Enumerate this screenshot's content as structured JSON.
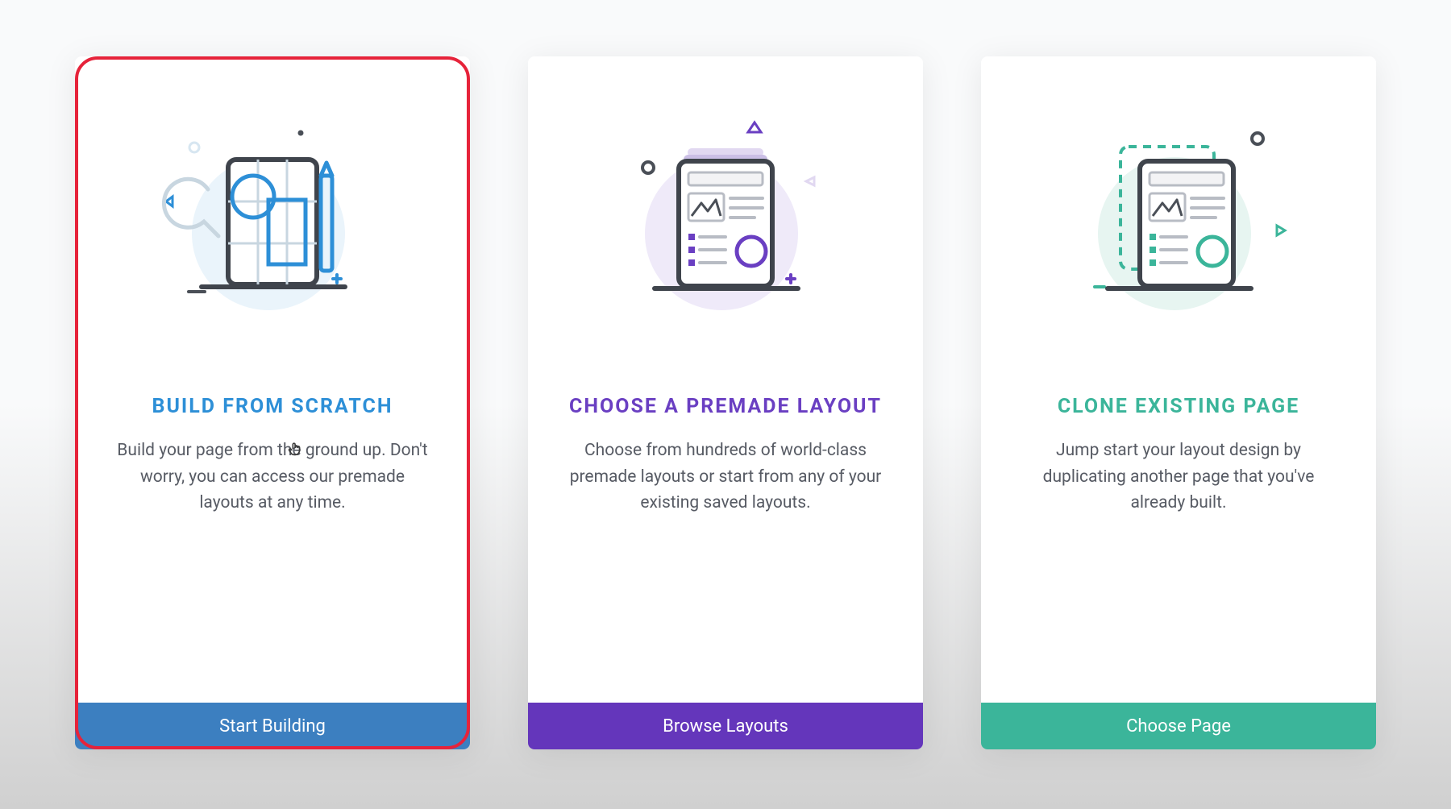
{
  "cards": [
    {
      "title": "BUILD FROM SCRATCH",
      "desc": "Build your page from the ground up. Don't worry, you can access our premade layouts at any time.",
      "button": "Start Building"
    },
    {
      "title": "CHOOSE A PREMADE LAYOUT",
      "desc": "Choose from hundreds of world-class premade layouts or start from any of your existing saved layouts.",
      "button": "Browse Layouts"
    },
    {
      "title": "CLONE EXISTING PAGE",
      "desc": "Jump start your layout design by duplicating another page that you've already built.",
      "button": "Choose Page"
    }
  ],
  "colors": {
    "blue": "#2d8fd7",
    "purple": "#6a3fc2",
    "teal": "#3bb59a",
    "highlight": "#e6233a"
  },
  "icons": {
    "scratch": "scratch-document-icon",
    "premade": "premade-layout-icon",
    "clone": "clone-page-icon"
  }
}
